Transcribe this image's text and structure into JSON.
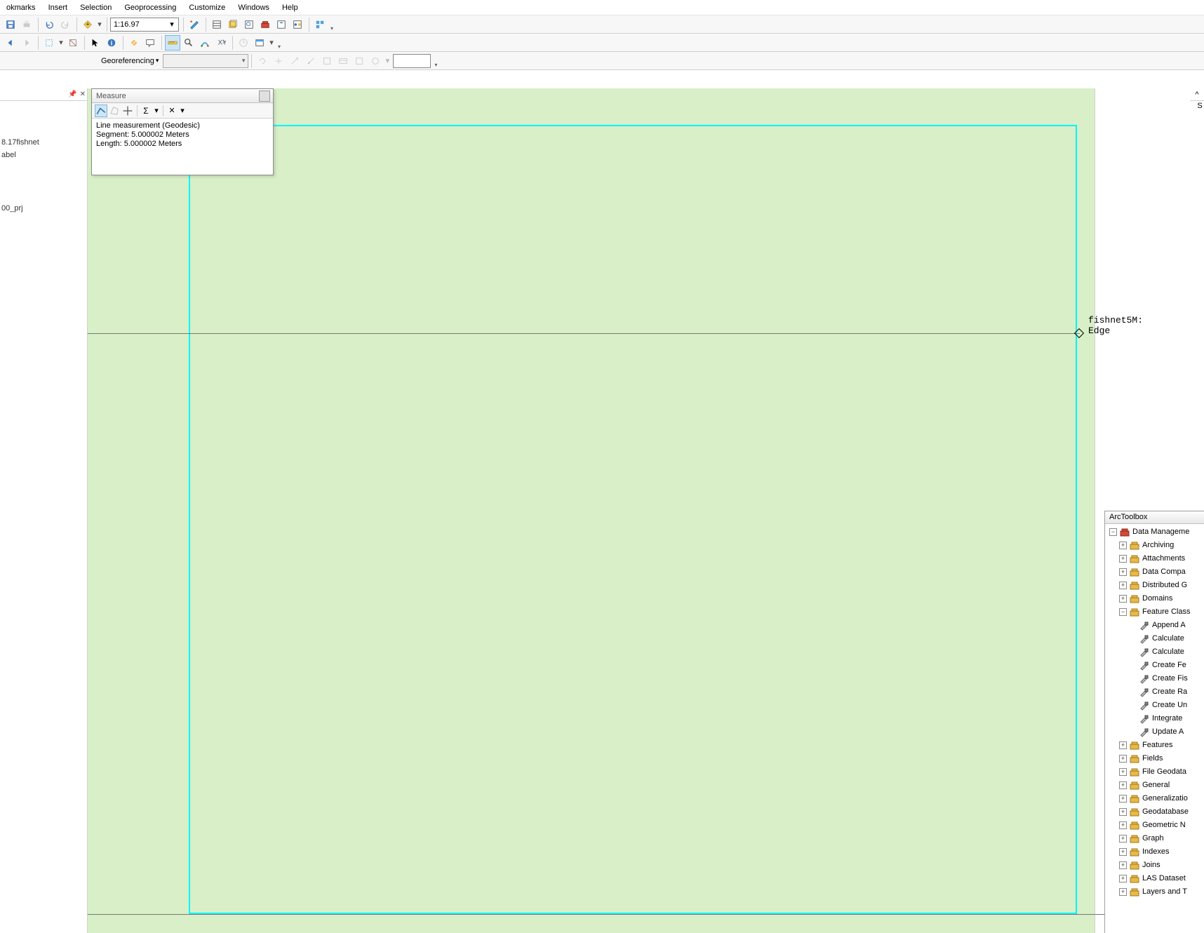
{
  "menu": {
    "items": [
      "okmarks",
      "Insert",
      "Selection",
      "Geoprocessing",
      "Customize",
      "Windows",
      "Help"
    ]
  },
  "scale": "1:16.97",
  "georef": {
    "label": "Georeferencing"
  },
  "toc": {
    "item1": "8.17fishnet",
    "item2": "abel",
    "item3": "00_prj"
  },
  "measure": {
    "title": "Measure",
    "line1": "Line measurement (Geodesic)",
    "line2": "Segment: 5.000002 Meters",
    "line3": "Length: 5.000002 Meters"
  },
  "snap_label": "fishnet5M: Edge",
  "arctoolbox": {
    "title": "ArcToolbox",
    "root": "Data Manageme",
    "sets": [
      "Archiving",
      "Attachments",
      "Data Compa",
      "Distributed G",
      "Domains",
      "Feature Class",
      "Features",
      "Fields",
      "File Geodata",
      "General",
      "Generalizatio",
      "Geodatabase",
      "Geometric N",
      "Graph",
      "Indexes",
      "Joins",
      "LAS Dataset",
      "Layers and T"
    ],
    "fc_tools": [
      "Append A",
      "Calculate",
      "Calculate",
      "Create Fe",
      "Create Fis",
      "Create Ra",
      "Create Un",
      "Integrate",
      "Update A"
    ]
  },
  "right_edge": {
    "pin": "^",
    "letter": "S"
  }
}
